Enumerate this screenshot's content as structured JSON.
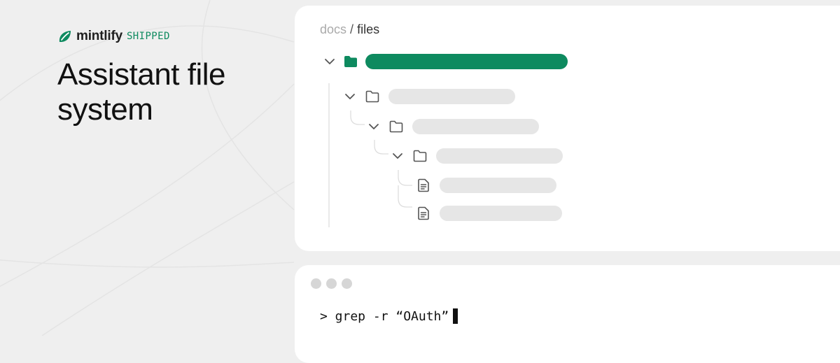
{
  "brand": {
    "name": "mintlify",
    "tag": "SHIPPED",
    "accent_color": "#0e8a5f"
  },
  "headline": "Assistant file system",
  "breadcrumb": {
    "root": "docs",
    "separator": "/",
    "current": "files"
  },
  "tree": {
    "items": [
      {
        "kind": "folder",
        "expanded": true,
        "selected": true,
        "icon": "folder-filled-icon"
      },
      {
        "kind": "folder",
        "expanded": true,
        "selected": false,
        "icon": "folder-icon"
      },
      {
        "kind": "folder",
        "expanded": true,
        "selected": false,
        "icon": "folder-icon"
      },
      {
        "kind": "folder",
        "expanded": true,
        "selected": false,
        "icon": "folder-icon"
      },
      {
        "kind": "file",
        "selected": false,
        "icon": "file-icon"
      },
      {
        "kind": "file",
        "selected": false,
        "icon": "file-icon"
      }
    ]
  },
  "terminal": {
    "window_controls": [
      "dot",
      "dot",
      "dot"
    ],
    "command": "> grep -r “OAuth”"
  }
}
